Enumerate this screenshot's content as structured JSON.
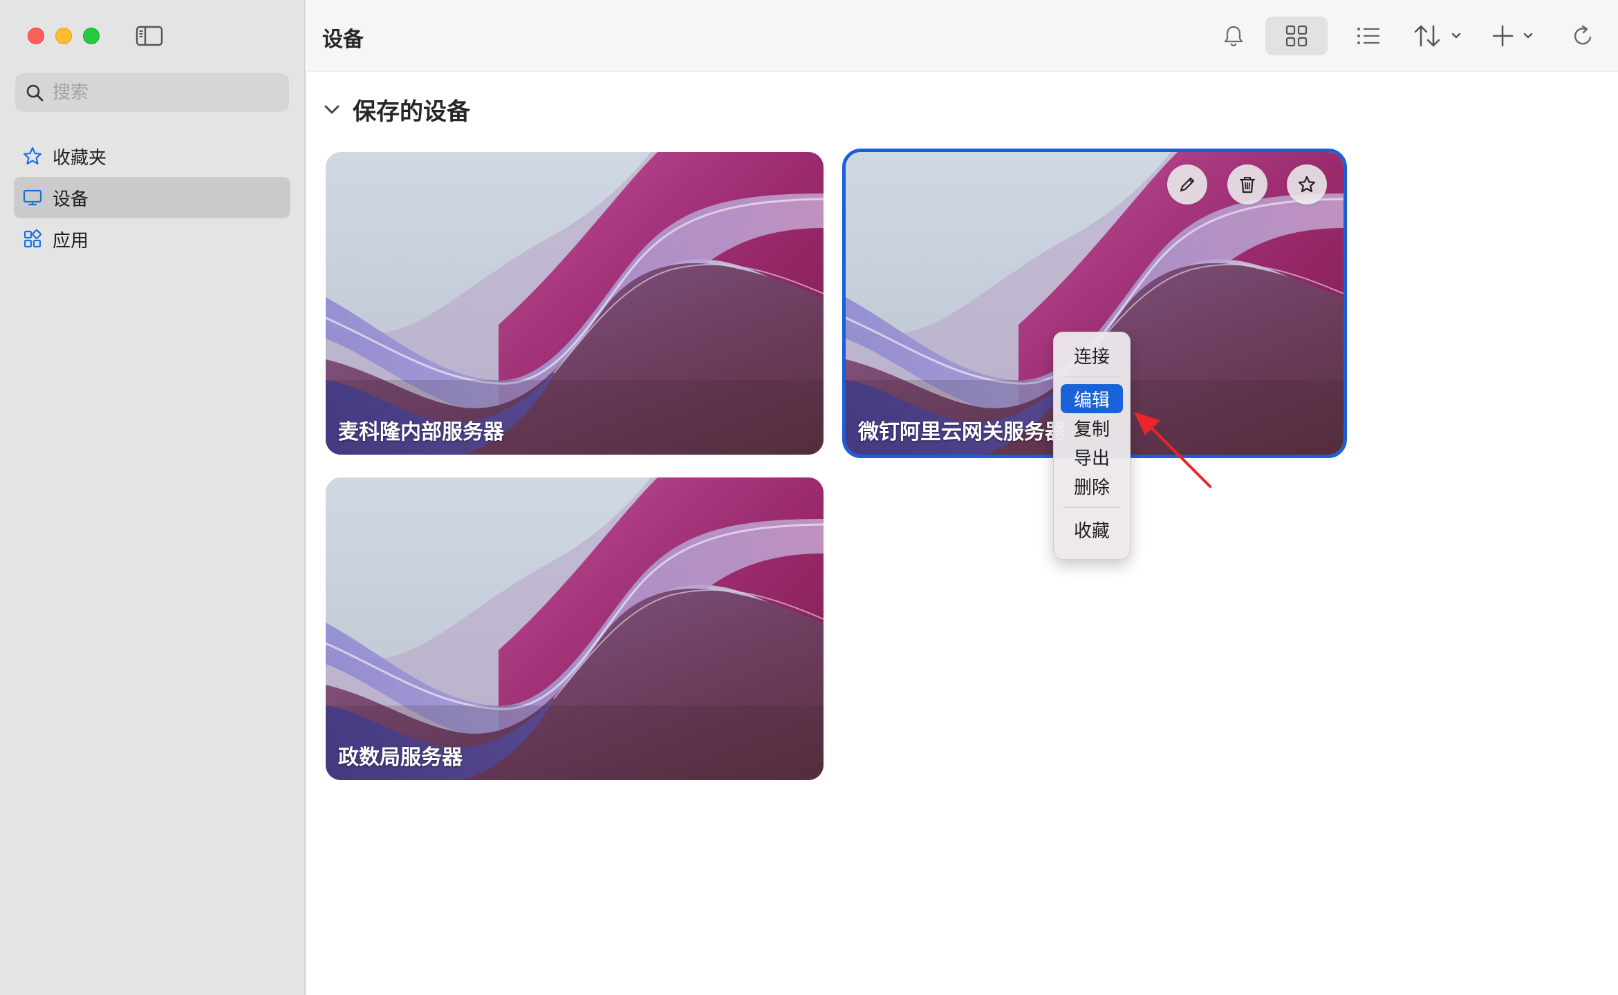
{
  "sidebar": {
    "search_placeholder": "搜索",
    "items": [
      {
        "label": "收藏夹",
        "icon": "star-icon",
        "active": false
      },
      {
        "label": "设备",
        "icon": "monitor-icon",
        "active": true
      },
      {
        "label": "应用",
        "icon": "apps-icon",
        "active": false
      }
    ]
  },
  "toolbar": {
    "title": "设备",
    "buttons": [
      "bell-icon",
      "grid-view-icon",
      "list-view-icon",
      "sort-icon",
      "add-icon",
      "refresh-icon"
    ]
  },
  "main": {
    "section_title": "保存的设备",
    "cards": [
      {
        "name": "麦科隆内部服务器"
      },
      {
        "name": "微钉阿里云网关服务器"
      },
      {
        "name": "政数局服务器"
      }
    ],
    "card_actions": [
      "edit-icon",
      "trash-icon",
      "star-icon"
    ]
  },
  "context_menu": {
    "items": [
      "连接",
      "编辑",
      "复制",
      "导出",
      "删除",
      "收藏"
    ],
    "highlighted": "编辑"
  },
  "colors": {
    "accent": "#1a5fd6",
    "sidebar_bg": "#e4e4e4",
    "annotation_arrow": "#e8262a"
  }
}
